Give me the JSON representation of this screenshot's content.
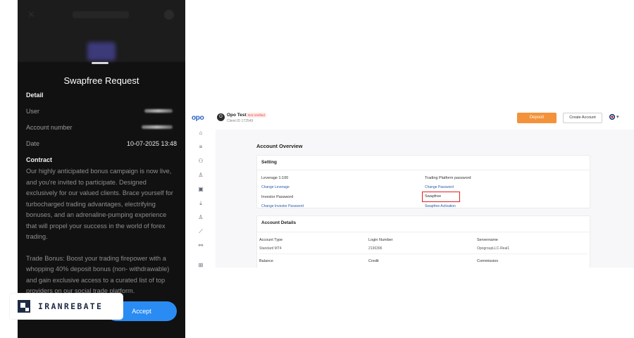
{
  "mobile": {
    "sheet_title": "Swapfree Request",
    "detail_heading": "Detail",
    "rows": [
      {
        "label": "User",
        "value": ""
      },
      {
        "label": "Account number",
        "value": ""
      },
      {
        "label": "Date",
        "value": "10-07-2025 13:48"
      }
    ],
    "contract_heading": "Contract",
    "contract_paragraphs": [
      "Our highly anticipated bonus campaign is now live, and you're invited to participate. Designed exclusively for our valued clients. Brace yourself for turbocharged trading advantages, electrifying bonuses, and an adrenaline-pumping experience that will propel your success in the world of forex trading.",
      "Trade Bonus: Boost your trading firepower with a whopping 40% deposit bonus (non- withdrawable) and gain exclusive access to a curated list of top providers on our social trade platform."
    ],
    "accept_label": "Accept"
  },
  "watermark": {
    "text": "IRANREBATE",
    "color": "#1d2a44"
  },
  "desktop": {
    "logo": "opo",
    "user": {
      "avatar_letter": "O",
      "name": "Opo Test",
      "status": "Not Verified",
      "client_id": "Client ID 172549"
    },
    "deposit_label": "Deposit",
    "create_account_label": "Create Account",
    "language_caret": "▾",
    "overview_title": "Account Overview",
    "setting": {
      "heading": "Setting",
      "leverage_label": "Leverage 1:100",
      "change_leverage": "Change Leverage",
      "platform_password_label": "Trading Platform password",
      "change_password": "Change Password",
      "investor_password_label": "Investor Password",
      "change_investor_password": "Change Investor Password",
      "swapfree_label": "Swapfree",
      "swapfree_activation": "Swapfree Activation"
    },
    "details": {
      "heading": "Account Details",
      "columns": [
        "Account Type",
        "Login Number",
        "Servername"
      ],
      "values": [
        "Standard MT4",
        "2136396",
        "OpogroupLLC-Real1"
      ],
      "columns2": [
        "Balance",
        "Credit",
        "Commission"
      ]
    },
    "sidebar_icons": [
      "home-icon",
      "filter-icon",
      "users-icon",
      "user-icon",
      "wallet-icon",
      "download-icon",
      "profile-icon",
      "chart-icon",
      "network-icon",
      "document-icon"
    ],
    "colors": {
      "deposit": "#f3923a",
      "link": "#2a5ca8",
      "highlight": "#e02020",
      "brand": "#2760c9"
    }
  }
}
